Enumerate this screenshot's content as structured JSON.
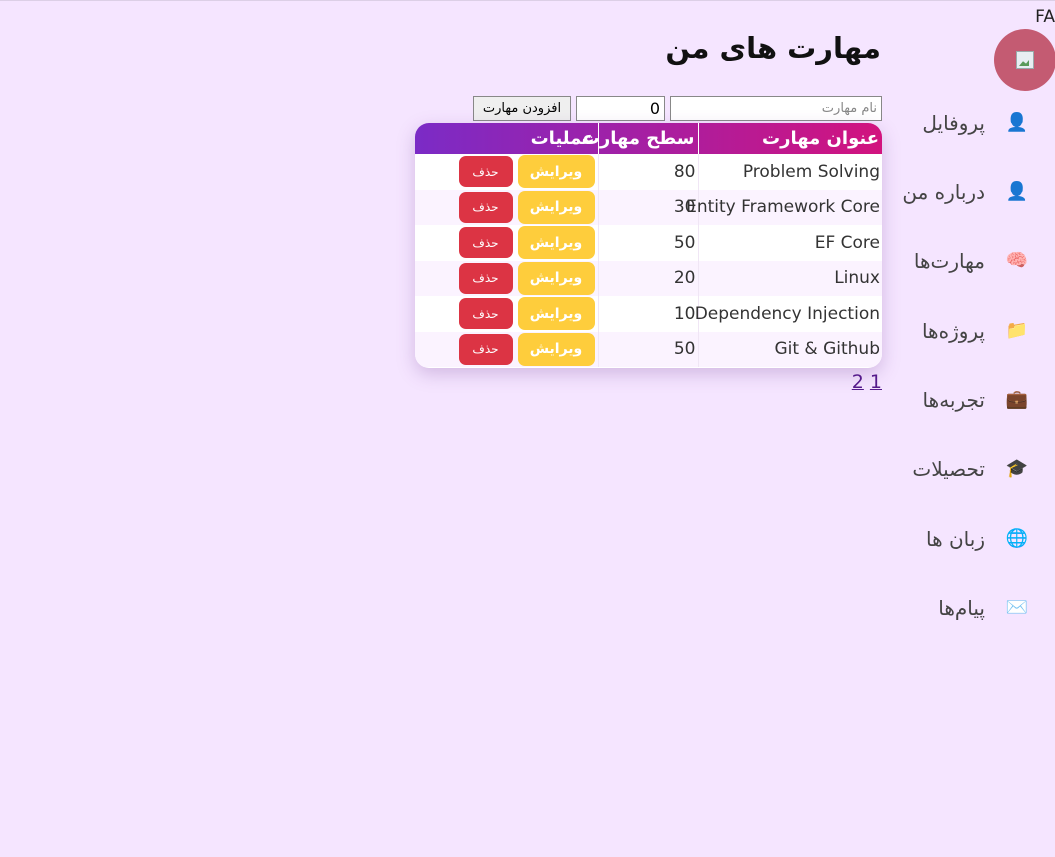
{
  "header": {
    "lang": "FA"
  },
  "sidebar": {
    "items": [
      {
        "label": "پروفایل",
        "icon": "👤"
      },
      {
        "label": "درباره من",
        "icon": "👤"
      },
      {
        "label": "مهارت‌ها",
        "icon": "🧠"
      },
      {
        "label": "پروژه‌ها",
        "icon": "📁"
      },
      {
        "label": "تجربه‌ها",
        "icon": "💼"
      },
      {
        "label": "تحصیلات",
        "icon": "🎓"
      },
      {
        "label": "زبان ها",
        "icon": "🌐"
      },
      {
        "label": "پیام‌ها",
        "icon": "✉️"
      }
    ]
  },
  "main": {
    "title": "مهارت های من",
    "form": {
      "name_placeholder": "نام مهارت",
      "level_value": "0",
      "add_label": "افزودن مهارت"
    },
    "table": {
      "columns": [
        "عنوان مهارت",
        "سطح مهارت",
        "عملیات"
      ],
      "rows": [
        {
          "name": "Problem Solving",
          "level": "80"
        },
        {
          "name": "Entity Framework Core",
          "level": "30"
        },
        {
          "name": "EF Core",
          "level": "50"
        },
        {
          "name": "Linux",
          "level": "20"
        },
        {
          "name": "Dependency Injection",
          "level": "10"
        },
        {
          "name": "Git & Github",
          "level": "50"
        }
      ],
      "edit_label": "ویرایش",
      "delete_label": "حذف"
    },
    "pagination": [
      "1",
      "2"
    ]
  }
}
